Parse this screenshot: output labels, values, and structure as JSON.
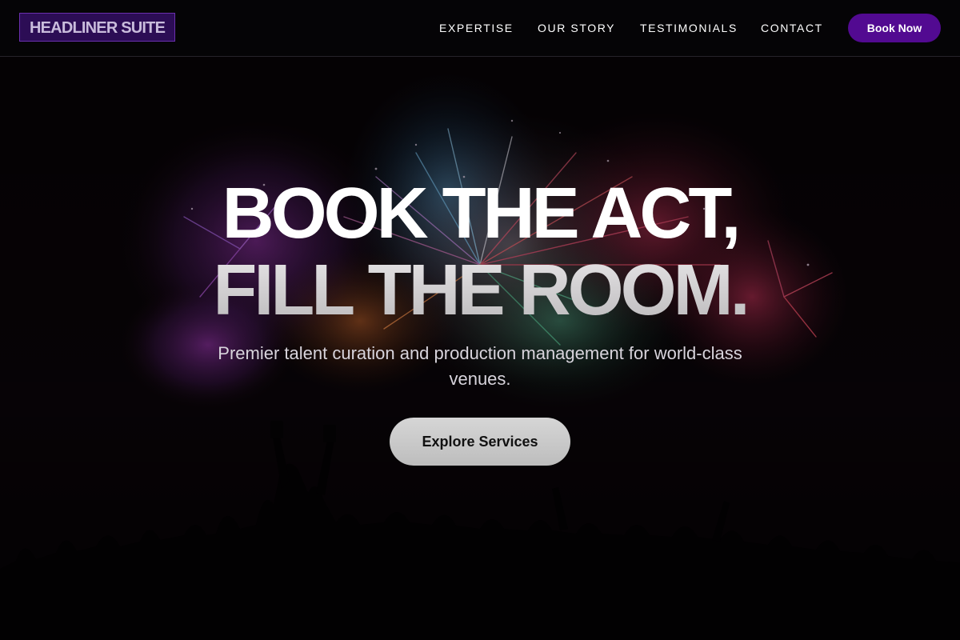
{
  "header": {
    "brand": "HEADLINER SUITE",
    "nav": [
      {
        "label": "EXPERTISE"
      },
      {
        "label": "OUR STORY"
      },
      {
        "label": "TESTIMONIALS"
      },
      {
        "label": "CONTACT"
      }
    ],
    "cta_label": "Book Now"
  },
  "hero": {
    "headline_line1": "BOOK THE ACT,",
    "headline_line2": "FILL THE ROOM.",
    "subtitle": "Premier talent curation and production management for world-class venues.",
    "cta_label": "Explore Services",
    "background_image": "fireworks-crowd-silhouette"
  },
  "colors": {
    "brand_purple": "#520a91",
    "brand_badge_bg": "#2c0d55",
    "page_bg": "#050305",
    "headline_primary": "#ffffff",
    "headline_secondary": "#c8c6c8",
    "cta_bg": "#cfcfcf"
  }
}
